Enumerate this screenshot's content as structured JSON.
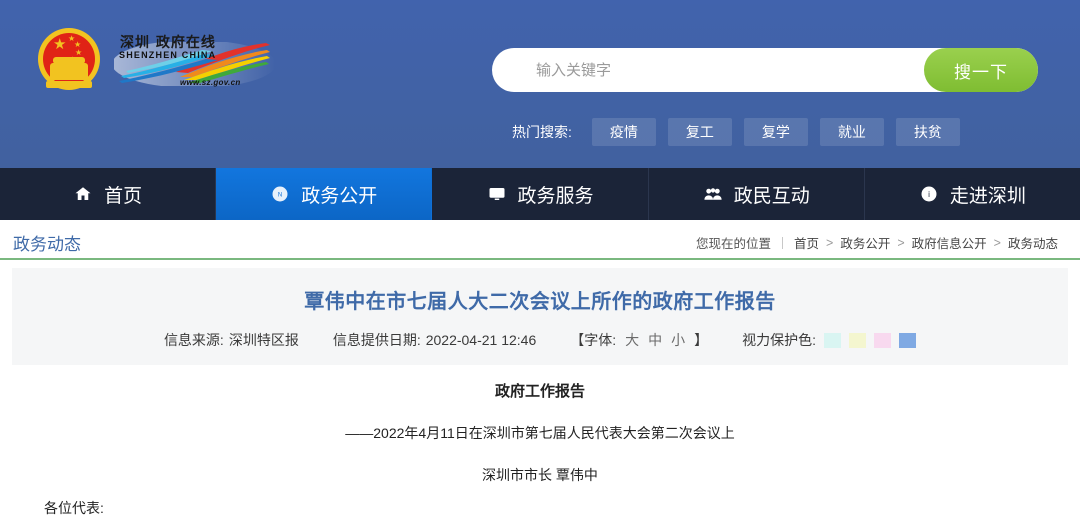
{
  "site": {
    "logo_emblem": "china-national-emblem",
    "wordmark_cn": "深圳 政府在线",
    "wordmark_en": "SHENZHEN CHINA",
    "wordmark_url": "www.sz.gov.cn"
  },
  "search": {
    "placeholder": "输入关键字",
    "value": "",
    "button_label": "搜一下",
    "hot_label": "热门搜索:",
    "hot_tags": [
      "疫情",
      "复工",
      "复学",
      "就业",
      "扶贫"
    ]
  },
  "nav": {
    "items": [
      {
        "label": "首页",
        "icon": "home-icon",
        "active": false
      },
      {
        "label": "政务公开",
        "icon": "news-icon",
        "active": true
      },
      {
        "label": "政务服务",
        "icon": "monitor-icon",
        "active": false
      },
      {
        "label": "政民互动",
        "icon": "people-icon",
        "active": false
      },
      {
        "label": "走进深圳",
        "icon": "info-circle-icon",
        "active": false
      }
    ]
  },
  "breadcrumb": {
    "section_title": "政务动态",
    "prefix": "您现在的位置",
    "path": [
      "首页",
      "政务公开",
      "政府信息公开",
      "政务动态"
    ],
    "separator": ">"
  },
  "article": {
    "title": "覃伟中在市七届人大二次会议上所作的政府工作报告",
    "source_label": "信息来源:",
    "source_value": "深圳特区报",
    "date_label": "信息提供日期:",
    "date_value": "2022-04-21 12:46",
    "font_label": "【字体:",
    "font_sizes": [
      "大",
      "中",
      "小"
    ],
    "font_label_end": "】",
    "eye_label": "视力保护色:",
    "eye_colors": [
      "#d9f5f2",
      "#f4f6cf",
      "#f8d9ef",
      "#7fa9e3"
    ],
    "body": {
      "heading": "政府工作报告",
      "subtitle": "——2022年4月11日在深圳市第七届人民代表大会第二次会议上",
      "speaker": "深圳市市长 覃伟中",
      "salutation": "各位代表:"
    }
  },
  "colors": {
    "header_blue": "#4162ab",
    "nav_dark": "#1b2438",
    "nav_active": "#0f6fd6",
    "search_green": "#8cc63e",
    "link_blue": "#3f6aa8",
    "divider_green": "#7ab87f",
    "panel_gray": "#f5f6f7"
  }
}
